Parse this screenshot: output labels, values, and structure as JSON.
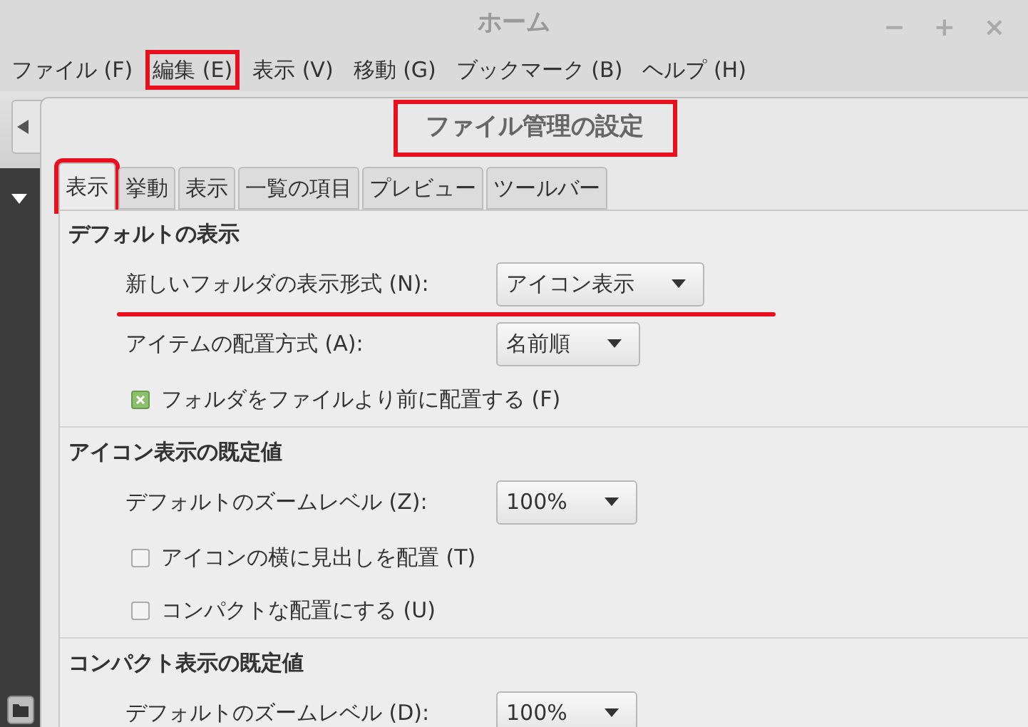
{
  "window": {
    "title": "ホーム",
    "controls": [
      "−",
      "+",
      "×"
    ]
  },
  "menu": [
    {
      "label": "ファイル (F)",
      "annotated": false
    },
    {
      "label": "編集 (E)",
      "annotated": true
    },
    {
      "label": "表示 (V)",
      "annotated": false
    },
    {
      "label": "移動 (G)",
      "annotated": false
    },
    {
      "label": "ブックマーク (B)",
      "annotated": false
    },
    {
      "label": "ヘルプ (H)",
      "annotated": false
    }
  ],
  "dialog": {
    "title": "ファイル管理の設定",
    "title_annotated": true,
    "tabs": [
      {
        "label": "表示",
        "selected": true,
        "annotated": true
      },
      {
        "label": "挙動",
        "selected": false,
        "annotated": false
      },
      {
        "label": "表示",
        "selected": false,
        "annotated": false
      },
      {
        "label": "一覧の項目",
        "selected": false,
        "annotated": false
      },
      {
        "label": "プレビュー",
        "selected": false,
        "annotated": false
      },
      {
        "label": "ツールバー",
        "selected": false,
        "annotated": false
      }
    ],
    "sections": [
      {
        "title": "デフォルトの表示",
        "rows": [
          {
            "kind": "select",
            "label": "新しいフォルダの表示形式 (N):",
            "value": "アイコン表示",
            "underlined": true
          },
          {
            "kind": "select",
            "label": "アイテムの配置方式 (A):",
            "value": "名前順"
          },
          {
            "kind": "checkbox",
            "label": "フォルダをファイルより前に配置する (F)",
            "checked": true
          }
        ]
      },
      {
        "title": "アイコン表示の既定値",
        "rows": [
          {
            "kind": "select",
            "label": "デフォルトのズームレベル (Z):",
            "value": "100%"
          },
          {
            "kind": "checkbox",
            "label": "アイコンの横に見出しを配置 (T)",
            "checked": false
          },
          {
            "kind": "checkbox",
            "label": "コンパクトな配置にする (U)",
            "checked": false
          }
        ]
      },
      {
        "title": "コンパクト表示の既定値",
        "rows": [
          {
            "kind": "select",
            "label": "デフォルトのズームレベル (D):",
            "value": "100%"
          }
        ]
      }
    ]
  }
}
